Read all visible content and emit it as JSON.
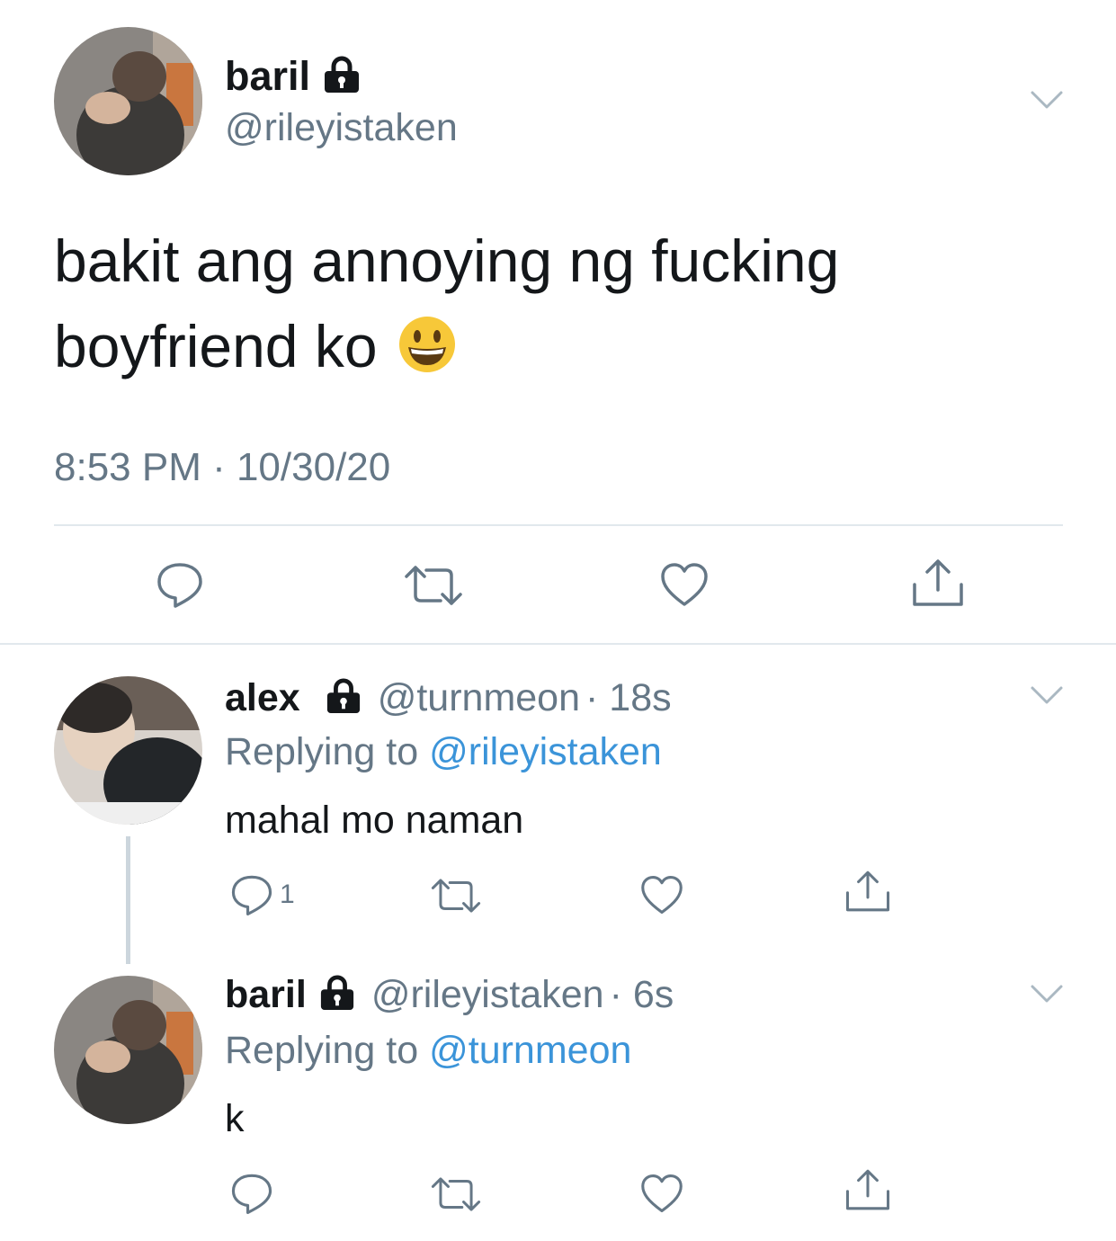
{
  "main_tweet": {
    "display_name": "baril",
    "handle": "@rileyistaken",
    "text_line1": "bakit ang annoying ng fucking",
    "text_line2": "boyfriend ko",
    "emoji": "😃",
    "timestamp": "8:53 PM · 10/30/20",
    "lock_icon": "lock-icon",
    "menu_icon": "chevron-down-icon",
    "actions": [
      "reply-icon",
      "retweet-icon",
      "like-icon",
      "share-icon"
    ]
  },
  "reply1": {
    "display_name": "alex",
    "handle": "@turnmeon",
    "time": "· 18s",
    "replying_prefix": "Replying to",
    "replying_to": "@rileyistaken",
    "text": "mahal mo naman",
    "reply_count": "1"
  },
  "reply2": {
    "display_name": "baril",
    "handle": "@rileyistaken",
    "time": "· 6s",
    "replying_prefix": "Replying to",
    "replying_to": "@turnmeon",
    "text": "k"
  },
  "colors": {
    "text": "#14171a",
    "muted": "#657786",
    "link": "#3b94d9",
    "divider": "#e1e8ed",
    "thread_line": "#ccd6dd"
  }
}
